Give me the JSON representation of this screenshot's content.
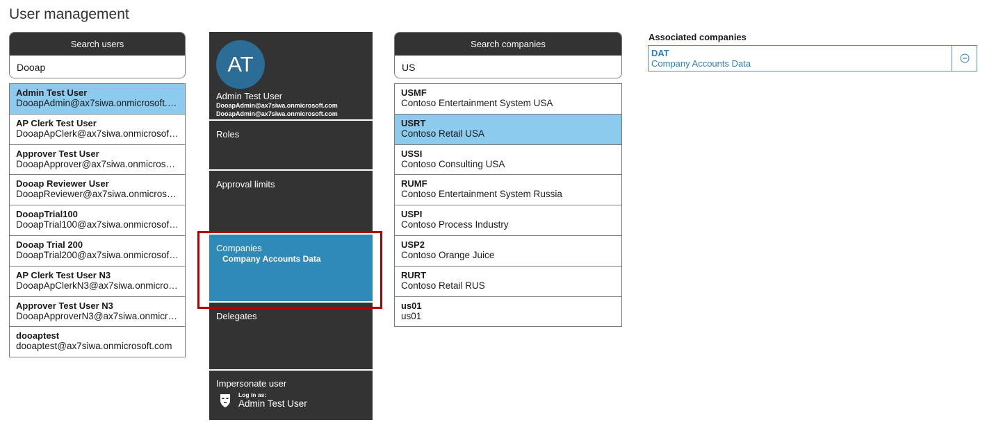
{
  "page": {
    "title": "User management"
  },
  "users_search": {
    "header": "Search users",
    "value": "Dooap",
    "items": [
      {
        "name": "Admin Test User",
        "email": "DooapAdmin@ax7siwa.onmicrosoft.c..."
      },
      {
        "name": "AP Clerk Test User",
        "email": "DooapApClerk@ax7siwa.onmicrosoft...."
      },
      {
        "name": "Approver Test User",
        "email": "DooapApprover@ax7siwa.onmicrosof..."
      },
      {
        "name": "Dooap Reviewer User",
        "email": "DooapReviewer@ax7siwa.onmicroso..."
      },
      {
        "name": "DooapTrial100",
        "email": "DooapTrial100@ax7siwa.onmicrosoft...."
      },
      {
        "name": "Dooap Trial 200",
        "email": "DooapTrial200@ax7siwa.onmicrosoft...."
      },
      {
        "name": "AP Clerk Test User N3",
        "email": "DooapApClerkN3@ax7siwa.onmicros..."
      },
      {
        "name": "Approver Test User N3",
        "email": "DooapApproverN3@ax7siwa.onmicro..."
      },
      {
        "name": "dooaptest",
        "email": "dooaptest@ax7siwa.onmicrosoft.com"
      }
    ]
  },
  "user_panel": {
    "initials": "AT",
    "name": "Admin Test User",
    "email1": "DooapAdmin@ax7siwa.onmicrosoft.com",
    "email2": "DooapAdmin@ax7siwa.onmicrosoft.com",
    "roles_label": "Roles",
    "approval_label": "Approval limits",
    "companies_label": "Companies",
    "companies_value": "Company Accounts Data",
    "delegates_label": "Delegates",
    "impersonate_label": "Impersonate user",
    "login_as_label": "Log in as:",
    "login_as_name": "Admin Test User"
  },
  "companies_search": {
    "header": "Search companies",
    "value": "US",
    "items": [
      {
        "code": "USMF",
        "name": "Contoso Entertainment System USA"
      },
      {
        "code": "USRT",
        "name": "Contoso Retail USA"
      },
      {
        "code": "USSI",
        "name": "Contoso Consulting USA"
      },
      {
        "code": "RUMF",
        "name": "Contoso Entertainment System Russia"
      },
      {
        "code": "USPI",
        "name": "Contoso Process Industry"
      },
      {
        "code": "USP2",
        "name": "Contoso Orange Juice"
      },
      {
        "code": "RURT",
        "name": "Contoso Retail RUS"
      },
      {
        "code": "us01",
        "name": "us01"
      }
    ]
  },
  "associated": {
    "title": "Associated companies",
    "items": [
      {
        "code": "DAT",
        "name": "Company Accounts Data"
      }
    ]
  },
  "colors": {
    "selected": "#8ccbee",
    "panel": "#333333",
    "active_section": "#2f8ab8",
    "highlight": "#b00000"
  },
  "icons": {
    "remove": "minus-circle-icon",
    "impersonate": "mask-icon"
  }
}
